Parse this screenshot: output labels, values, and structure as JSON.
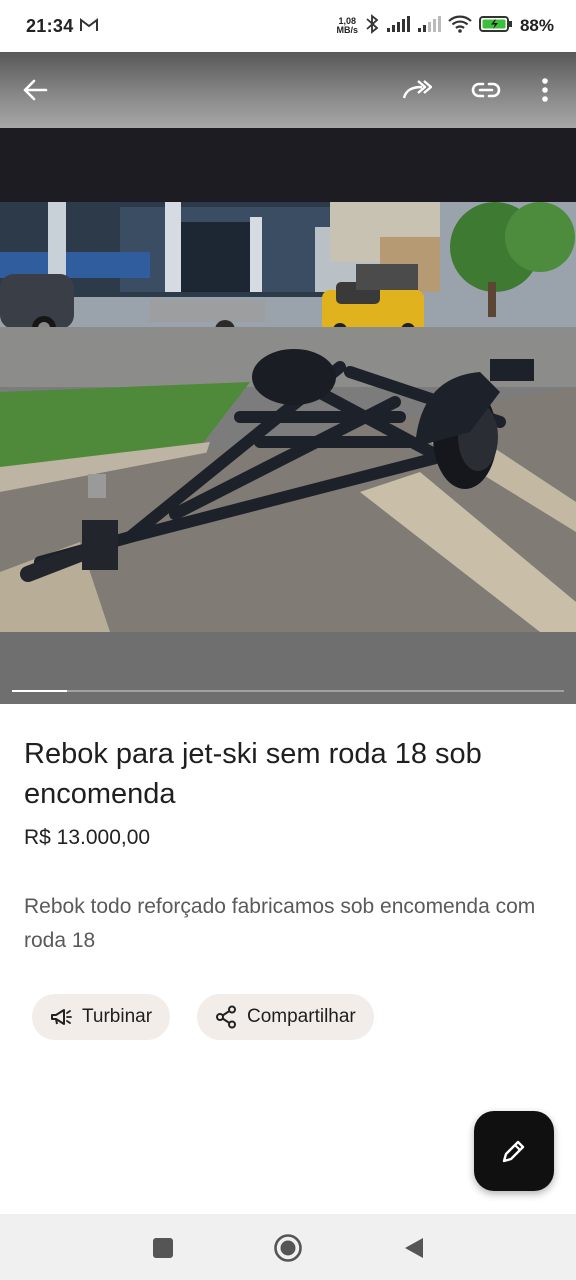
{
  "status_bar": {
    "time": "21:34",
    "notification_icon": "gmail-icon",
    "net_speed_value": "1,08",
    "net_speed_unit": "MB/s",
    "battery_percent": "88%",
    "icons": [
      "bluetooth-icon",
      "signal-icon",
      "signal-icon",
      "wifi-icon",
      "battery-charging-icon"
    ]
  },
  "toolbar": {
    "back_icon": "arrow-left-icon",
    "share_icon": "forward-arrow-icon",
    "link_icon": "link-icon",
    "more_icon": "more-vert-icon"
  },
  "gallery": {
    "progress_fraction": 0.1
  },
  "listing": {
    "title": "Rebok para jet-ski  sem roda 18 sob encomenda",
    "price": "R$ 13.000,00",
    "description": "Rebok todo reforçado  fabricamos sob encomenda com  roda 18"
  },
  "actions": {
    "boost_label": "Turbinar",
    "boost_icon": "megaphone-icon",
    "share_label": "Compartilhar",
    "share_icon": "share-nodes-icon"
  },
  "fab": {
    "icon": "pencil-icon"
  },
  "navbar": {
    "recents_icon": "square-icon",
    "home_icon": "circle-icon",
    "back_icon": "triangle-back-icon"
  },
  "colors": {
    "chip_bg": "#f2ede8",
    "fab_bg": "#101010",
    "trailer": "#1d2129"
  }
}
